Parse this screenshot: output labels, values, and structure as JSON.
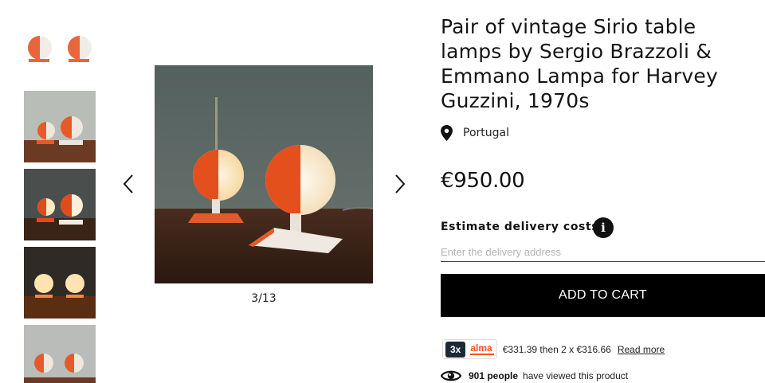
{
  "gallery": {
    "thumbnails": [
      {
        "name": "thumbnail-1"
      },
      {
        "name": "thumbnail-2"
      },
      {
        "name": "thumbnail-3"
      },
      {
        "name": "thumbnail-4"
      },
      {
        "name": "thumbnail-5"
      }
    ],
    "counter": "3/13",
    "prev_icon": "chevron-left-icon",
    "next_icon": "chevron-right-icon"
  },
  "product": {
    "title": "Pair of vintage Sirio table lamps by Sergio Brazzoli & Emmano Lampa for Harvey Guzzini, 1970s",
    "location": "Portugal",
    "location_icon": "map-pin-icon",
    "price": "€950.00"
  },
  "delivery": {
    "label": "Estimate delivery costs",
    "info_icon": "i",
    "placeholder": "Enter the delivery address",
    "value": ""
  },
  "cart": {
    "button_label": "ADD TO CART",
    "button_color": "#000000"
  },
  "financing": {
    "installments_badge": "3x",
    "provider": "alma",
    "provider_color": "#fa5022",
    "text": "€331.39 then 2 x €316.66",
    "link_label": "Read more"
  },
  "views": {
    "icon": "eye-icon",
    "count": "901 people",
    "text": "have viewed this product"
  }
}
